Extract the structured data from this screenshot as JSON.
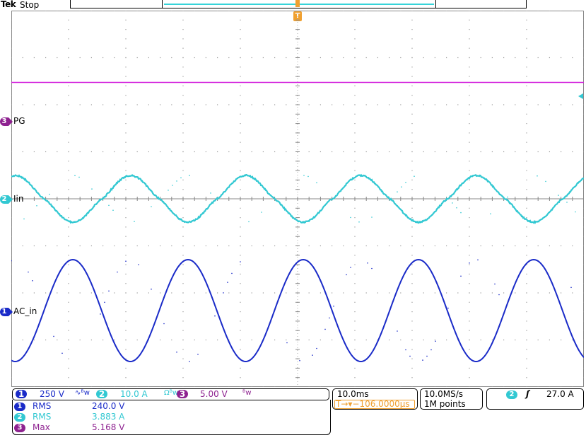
{
  "header": {
    "brand": "Tek",
    "status": "Stop"
  },
  "trigger_marker": "T",
  "colors": {
    "ch1": "#1a2bc8",
    "ch2": "#32c8d2",
    "ch3": "#d21edc",
    "ch3_badge": "#8e2290",
    "trigger": "#f0a030",
    "grid": "#9a9a9a"
  },
  "waveforms": {
    "ch3": {
      "number": "3",
      "label": "PG"
    },
    "ch2": {
      "number": "2",
      "label": "Iin"
    },
    "ch1": {
      "number": "1",
      "label": "AC_in"
    }
  },
  "channels": {
    "ch1": {
      "number": "1",
      "scale": "250 V",
      "coupling_icon": "ac-coupling-icon",
      "coupling": "∿ᴮw"
    },
    "ch2": {
      "number": "2",
      "scale": "10.0 A",
      "coupling_icon": "impedance-bw-icon",
      "coupling": "Ωᴮw"
    },
    "ch3": {
      "number": "3",
      "scale": "5.00 V",
      "coupling_icon": "bw-limit-icon",
      "coupling": "ᴮw"
    }
  },
  "timebase": {
    "scale": "10.0ms",
    "position_icon": "trigger-position-icon",
    "position": "T→▾−106.0000µs"
  },
  "acquisition": {
    "rate": "10.0MS/s",
    "points": "1M points"
  },
  "trigger": {
    "channel": "2",
    "slope_icon": "rising-edge-icon",
    "slope": "ʃ",
    "level": "27.0 A"
  },
  "measurements": [
    {
      "channel": "1",
      "name": "RMS",
      "value": "240.0 V"
    },
    {
      "channel": "2",
      "name": "RMS",
      "value": "3.883 A"
    },
    {
      "channel": "3",
      "name": "Max",
      "value": "5.168 V"
    }
  ]
}
